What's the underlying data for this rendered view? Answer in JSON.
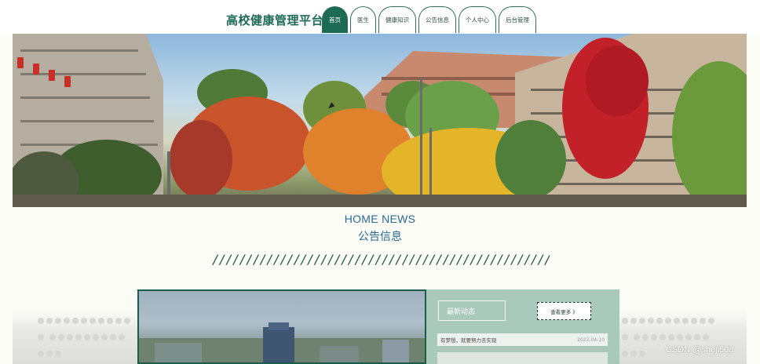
{
  "header": {
    "site_title": "高校健康管理平台",
    "nav": [
      {
        "label": "首页",
        "active": true
      },
      {
        "label": "医生",
        "active": false
      },
      {
        "label": "健康知识",
        "active": false
      },
      {
        "label": "公告信息",
        "active": false
      },
      {
        "label": "个人中心",
        "active": false
      },
      {
        "label": "后台管理",
        "active": false
      }
    ]
  },
  "section": {
    "heading_en": "HOME NEWS",
    "heading_cn": "公告信息",
    "divider": "//////////////////////////////////////////////////////////"
  },
  "news_panel": {
    "latest_label": "最新动态",
    "more_label": "查看更多 》",
    "items": [
      {
        "title": "有梦想，就要努力去实现",
        "date": "2022-04-10"
      }
    ]
  },
  "watermark": "CSDN @sheji508",
  "colors": {
    "brand_green": "#1e6b54",
    "heading_blue": "#2b6a8f",
    "panel_green": "#a9c9bb"
  }
}
